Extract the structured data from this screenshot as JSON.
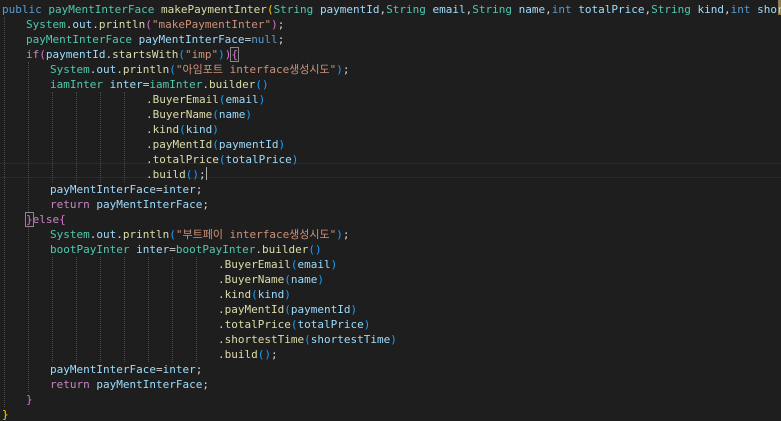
{
  "editor": {
    "lines": [
      {
        "indent": 0,
        "tokens": [
          {
            "t": "public",
            "c": "kw"
          },
          {
            "t": " ",
            "c": "pun"
          },
          {
            "t": "payMentInterFace",
            "c": "ty"
          },
          {
            "t": " ",
            "c": "pun"
          },
          {
            "t": "makePaymentInter",
            "c": "fn"
          },
          {
            "t": "(",
            "c": "br1"
          },
          {
            "t": "String",
            "c": "ty"
          },
          {
            "t": " ",
            "c": "pun"
          },
          {
            "t": "paymentId",
            "c": "var"
          },
          {
            "t": ",",
            "c": "pun"
          },
          {
            "t": "String",
            "c": "ty"
          },
          {
            "t": " ",
            "c": "pun"
          },
          {
            "t": "email",
            "c": "var"
          },
          {
            "t": ",",
            "c": "pun"
          },
          {
            "t": "String",
            "c": "ty"
          },
          {
            "t": " ",
            "c": "pun"
          },
          {
            "t": "name",
            "c": "var"
          },
          {
            "t": ",",
            "c": "pun"
          },
          {
            "t": "int",
            "c": "kw"
          },
          {
            "t": " ",
            "c": "pun"
          },
          {
            "t": "totalPrice",
            "c": "var"
          },
          {
            "t": ",",
            "c": "pun"
          },
          {
            "t": "String",
            "c": "ty"
          },
          {
            "t": " ",
            "c": "pun"
          },
          {
            "t": "kind",
            "c": "var"
          },
          {
            "t": ",",
            "c": "pun"
          },
          {
            "t": "int",
            "c": "kw"
          },
          {
            "t": " ",
            "c": "pun"
          },
          {
            "t": "shortestTime",
            "c": "var"
          },
          {
            "t": ")",
            "c": "br1"
          },
          {
            "t": " ",
            "c": "pun"
          },
          {
            "t": "{",
            "c": "br1"
          }
        ]
      },
      {
        "indent": 1,
        "tokens": [
          {
            "t": "System",
            "c": "ty"
          },
          {
            "t": ".",
            "c": "pun"
          },
          {
            "t": "out",
            "c": "var"
          },
          {
            "t": ".",
            "c": "pun"
          },
          {
            "t": "println",
            "c": "fn"
          },
          {
            "t": "(",
            "c": "br2"
          },
          {
            "t": "\"makePaymentInter\"",
            "c": "str"
          },
          {
            "t": ")",
            "c": "br2"
          },
          {
            "t": ";",
            "c": "pun"
          }
        ]
      },
      {
        "indent": 1,
        "tokens": [
          {
            "t": "payMentInterFace",
            "c": "ty"
          },
          {
            "t": " ",
            "c": "pun"
          },
          {
            "t": "payMentInterFace",
            "c": "var"
          },
          {
            "t": "=",
            "c": "pun"
          },
          {
            "t": "null",
            "c": "kw"
          },
          {
            "t": ";",
            "c": "pun"
          }
        ]
      },
      {
        "indent": 1,
        "tokens": [
          {
            "t": "if",
            "c": "ctl"
          },
          {
            "t": "(",
            "c": "br2"
          },
          {
            "t": "paymentId",
            "c": "var"
          },
          {
            "t": ".",
            "c": "pun"
          },
          {
            "t": "startsWith",
            "c": "fn"
          },
          {
            "t": "(",
            "c": "br3"
          },
          {
            "t": "\"imp\"",
            "c": "str"
          },
          {
            "t": ")",
            "c": "br3"
          },
          {
            "t": ")",
            "c": "br2"
          },
          {
            "t": "{",
            "c": "br2",
            "match": true
          }
        ]
      },
      {
        "indent": 2,
        "tokens": [
          {
            "t": "System",
            "c": "ty"
          },
          {
            "t": ".",
            "c": "pun"
          },
          {
            "t": "out",
            "c": "var"
          },
          {
            "t": ".",
            "c": "pun"
          },
          {
            "t": "println",
            "c": "fn"
          },
          {
            "t": "(",
            "c": "br3"
          },
          {
            "t": "\"아임포트 interface생성시도\"",
            "c": "str"
          },
          {
            "t": ")",
            "c": "br3"
          },
          {
            "t": ";",
            "c": "pun"
          }
        ]
      },
      {
        "indent": 2,
        "tokens": [
          {
            "t": "iamInter",
            "c": "ty"
          },
          {
            "t": " ",
            "c": "pun"
          },
          {
            "t": "inter",
            "c": "var"
          },
          {
            "t": "=",
            "c": "pun"
          },
          {
            "t": "iamInter",
            "c": "ty"
          },
          {
            "t": ".",
            "c": "pun"
          },
          {
            "t": "builder",
            "c": "fn"
          },
          {
            "t": "(",
            "c": "br3"
          },
          {
            "t": ")",
            "c": "br3"
          }
        ]
      },
      {
        "indent": 6,
        "tokens": [
          {
            "t": ".",
            "c": "pun"
          },
          {
            "t": "BuyerEmail",
            "c": "fn"
          },
          {
            "t": "(",
            "c": "br3"
          },
          {
            "t": "email",
            "c": "var"
          },
          {
            "t": ")",
            "c": "br3"
          }
        ]
      },
      {
        "indent": 6,
        "tokens": [
          {
            "t": ".",
            "c": "pun"
          },
          {
            "t": "BuyerName",
            "c": "fn"
          },
          {
            "t": "(",
            "c": "br3"
          },
          {
            "t": "name",
            "c": "var"
          },
          {
            "t": ")",
            "c": "br3"
          }
        ]
      },
      {
        "indent": 6,
        "tokens": [
          {
            "t": ".",
            "c": "pun"
          },
          {
            "t": "kind",
            "c": "fn"
          },
          {
            "t": "(",
            "c": "br3"
          },
          {
            "t": "kind",
            "c": "var"
          },
          {
            "t": ")",
            "c": "br3"
          }
        ]
      },
      {
        "indent": 6,
        "tokens": [
          {
            "t": ".",
            "c": "pun"
          },
          {
            "t": "payMentId",
            "c": "fn"
          },
          {
            "t": "(",
            "c": "br3"
          },
          {
            "t": "paymentId",
            "c": "var"
          },
          {
            "t": ")",
            "c": "br3"
          }
        ]
      },
      {
        "indent": 6,
        "tokens": [
          {
            "t": ".",
            "c": "pun"
          },
          {
            "t": "totalPrice",
            "c": "fn"
          },
          {
            "t": "(",
            "c": "br3"
          },
          {
            "t": "totalPrice",
            "c": "var"
          },
          {
            "t": ")",
            "c": "br3"
          }
        ]
      },
      {
        "indent": 6,
        "tokens": [
          {
            "t": ".",
            "c": "pun"
          },
          {
            "t": "build",
            "c": "fn"
          },
          {
            "t": "(",
            "c": "br3"
          },
          {
            "t": ")",
            "c": "br3"
          },
          {
            "t": ";",
            "c": "pun"
          }
        ],
        "cursor": true
      },
      {
        "indent": 2,
        "tokens": [
          {
            "t": "payMentInterFace",
            "c": "var"
          },
          {
            "t": "=",
            "c": "pun"
          },
          {
            "t": "inter",
            "c": "var"
          },
          {
            "t": ";",
            "c": "pun"
          }
        ]
      },
      {
        "indent": 2,
        "tokens": [
          {
            "t": "return",
            "c": "ctl"
          },
          {
            "t": " ",
            "c": "pun"
          },
          {
            "t": "payMentInterFace",
            "c": "var"
          },
          {
            "t": ";",
            "c": "pun"
          }
        ]
      },
      {
        "indent": 1,
        "tokens": [
          {
            "t": "}",
            "c": "br2",
            "match": true
          },
          {
            "t": "else",
            "c": "ctl"
          },
          {
            "t": "{",
            "c": "br2"
          }
        ]
      },
      {
        "indent": 2,
        "tokens": [
          {
            "t": "System",
            "c": "ty"
          },
          {
            "t": ".",
            "c": "pun"
          },
          {
            "t": "out",
            "c": "var"
          },
          {
            "t": ".",
            "c": "pun"
          },
          {
            "t": "println",
            "c": "fn"
          },
          {
            "t": "(",
            "c": "br3"
          },
          {
            "t": "\"부트페이 interface생성시도\"",
            "c": "str"
          },
          {
            "t": ")",
            "c": "br3"
          },
          {
            "t": ";",
            "c": "pun"
          }
        ]
      },
      {
        "indent": 2,
        "tokens": [
          {
            "t": "bootPayInter",
            "c": "ty"
          },
          {
            "t": " ",
            "c": "pun"
          },
          {
            "t": "inter",
            "c": "var"
          },
          {
            "t": "=",
            "c": "pun"
          },
          {
            "t": "bootPayInter",
            "c": "ty"
          },
          {
            "t": ".",
            "c": "pun"
          },
          {
            "t": "builder",
            "c": "fn"
          },
          {
            "t": "(",
            "c": "br3"
          },
          {
            "t": ")",
            "c": "br3"
          }
        ]
      },
      {
        "indent": 9,
        "tokens": [
          {
            "t": ".",
            "c": "pun"
          },
          {
            "t": "BuyerEmail",
            "c": "fn"
          },
          {
            "t": "(",
            "c": "br3"
          },
          {
            "t": "email",
            "c": "var"
          },
          {
            "t": ")",
            "c": "br3"
          }
        ]
      },
      {
        "indent": 9,
        "tokens": [
          {
            "t": ".",
            "c": "pun"
          },
          {
            "t": "BuyerName",
            "c": "fn"
          },
          {
            "t": "(",
            "c": "br3"
          },
          {
            "t": "name",
            "c": "var"
          },
          {
            "t": ")",
            "c": "br3"
          }
        ]
      },
      {
        "indent": 9,
        "tokens": [
          {
            "t": ".",
            "c": "pun"
          },
          {
            "t": "kind",
            "c": "fn"
          },
          {
            "t": "(",
            "c": "br3"
          },
          {
            "t": "kind",
            "c": "var"
          },
          {
            "t": ")",
            "c": "br3"
          }
        ]
      },
      {
        "indent": 9,
        "tokens": [
          {
            "t": ".",
            "c": "pun"
          },
          {
            "t": "payMentId",
            "c": "fn"
          },
          {
            "t": "(",
            "c": "br3"
          },
          {
            "t": "paymentId",
            "c": "var"
          },
          {
            "t": ")",
            "c": "br3"
          }
        ]
      },
      {
        "indent": 9,
        "tokens": [
          {
            "t": ".",
            "c": "pun"
          },
          {
            "t": "totalPrice",
            "c": "fn"
          },
          {
            "t": "(",
            "c": "br3"
          },
          {
            "t": "totalPrice",
            "c": "var"
          },
          {
            "t": ")",
            "c": "br3"
          }
        ]
      },
      {
        "indent": 9,
        "tokens": [
          {
            "t": ".",
            "c": "pun"
          },
          {
            "t": "shortestTime",
            "c": "fn"
          },
          {
            "t": "(",
            "c": "br3"
          },
          {
            "t": "shortestTime",
            "c": "var"
          },
          {
            "t": ")",
            "c": "br3"
          }
        ]
      },
      {
        "indent": 9,
        "tokens": [
          {
            "t": ".",
            "c": "pun"
          },
          {
            "t": "build",
            "c": "fn"
          },
          {
            "t": "(",
            "c": "br3"
          },
          {
            "t": ")",
            "c": "br3"
          },
          {
            "t": ";",
            "c": "pun"
          }
        ]
      },
      {
        "indent": 2,
        "tokens": [
          {
            "t": "payMentInterFace",
            "c": "var"
          },
          {
            "t": "=",
            "c": "pun"
          },
          {
            "t": "inter",
            "c": "var"
          },
          {
            "t": ";",
            "c": "pun"
          }
        ]
      },
      {
        "indent": 2,
        "tokens": [
          {
            "t": "return",
            "c": "ctl"
          },
          {
            "t": " ",
            "c": "pun"
          },
          {
            "t": "payMentInterFace",
            "c": "var"
          },
          {
            "t": ";",
            "c": "pun"
          }
        ]
      },
      {
        "indent": 1,
        "tokens": [
          {
            "t": "}",
            "c": "br2"
          }
        ]
      },
      {
        "indent": 0,
        "tokens": [
          {
            "t": "}",
            "c": "br1"
          }
        ]
      }
    ]
  },
  "colors": {
    "background": "#1e1e1e",
    "keyword": "#569cd6",
    "control": "#c586c0",
    "type": "#4ec9b0",
    "function": "#dcdcaa",
    "variable": "#9cdcfe",
    "string": "#ce9178",
    "bracket_level1": "#ffd700",
    "bracket_level2": "#da70d6",
    "bracket_level3": "#179fff"
  }
}
